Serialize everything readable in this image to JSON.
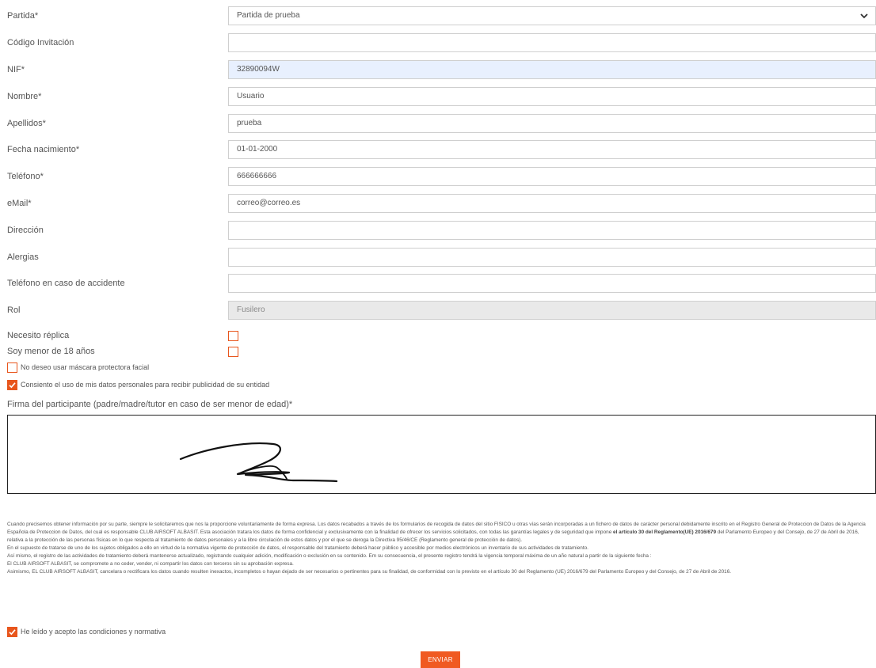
{
  "form": {
    "fields": [
      {
        "label": "Partida*",
        "value": "Partida de prueba",
        "type": "select"
      },
      {
        "label": "Código Invitación",
        "value": "",
        "type": "text"
      },
      {
        "label": "NIF*",
        "value": "32890094W",
        "type": "text"
      },
      {
        "label": "Nombre*",
        "value": "Usuario",
        "type": "text"
      },
      {
        "label": "Apellidos*",
        "value": "prueba",
        "type": "text"
      },
      {
        "label": "Fecha nacimiento*",
        "value": "01-01-2000",
        "type": "text"
      },
      {
        "label": "Teléfono*",
        "value": "666666666",
        "type": "text"
      },
      {
        "label": "eMail*",
        "value": "correo@correo.es",
        "type": "text"
      },
      {
        "label": "Dirección",
        "value": "",
        "type": "text"
      },
      {
        "label": "Alergias",
        "value": "",
        "type": "text"
      },
      {
        "label": "Teléfono en caso de accidente",
        "value": "",
        "type": "text"
      },
      {
        "label": "Rol",
        "value": "Fusilero",
        "type": "text"
      }
    ],
    "checkboxes": [
      {
        "label": "Necesito réplica",
        "checked": false
      },
      {
        "label": "Soy menor de 18 años",
        "checked": false
      },
      {
        "label": "No deseo usar máscara protectora facial",
        "checked": false
      },
      {
        "label": "Consiento el uso de mis datos personales para recibir publicidad de su entidad",
        "checked": true
      }
    ],
    "signature_label": "Firma del participante (padre/madre/tutor en caso de ser menor de edad)*",
    "legal": {
      "p1_a": "Cuando precisemos obtener información por su parte, siempre le solicitaremos que nos la proporcione voluntariamente de forma expresa. Los datos recabados a través de los formularios de recogida de datos del sitio FISICO u otras vías serán incorporadas a un fichero de datos de carácter personal debidamente inscrito en el Registro General de Proteccion de Datos de la Agencia Española de Proteccion de Datos, del cual es responsable CLUB AIRSOFT ALBASIT. Esta asociación tratara los datos de forma confidencial y exclusivamente con la finalidad de ofrecer los servicios solicitados, con todas las garantías legales y de seguridad que impone ",
      "p1_bold": "el artículo 30 del Reglamento(UE) 2016/679",
      "p1_b": " del Parlamento Europeo y del Consejo, de 27 de Abril de 2016, relativa a la protección de las personas físicas en lo que respecta al tratamiento de datos personales y a la libre circulación de estos datos y por el que se deroga la Directiva 95/46/CE (Reglamento general de protección de datos).",
      "p2": "En el supuesto de tratarse de uno de los sujetos obligados a ello en virtud de la normativa vigente de protección de datos, el responsable del tratamiento deberá hacer público y accesible por medios electrónicos un inventario de sus actividades de tratamiento.",
      "p3": "Así mismo, el registro de las actividades de tratamiento deberá mantenerse actualizado, registrando cualquier adición, modificación o exclusión en su contenido. Em su consecuencia, el presente registro tendrá la vigencia temporal máxima de un año natural a partir de la siguiente fecha :",
      "p4": "El CLUB AIRSOFT ALBASIT, se compromete a no ceder, vender, ni compartir los datos con terceros sin su aprobación expresa.",
      "p5": "Asimismo, EL CLUB AIRSOFT ALBASIT, cancelara o rectificara los datos cuando resulten inexactos, incompletos o hayan dejado de ser necesarios o pertinentes para su finalidad, de conformidad con lo previsto en el artículo 30 del Reglamento (UE) 2016/679 del Parlamento Europeo y del Consejo, de 27 de Abril de 2016."
    },
    "accept_label": "He leído y acepto las condiciones y normativa",
    "accept_checked": true,
    "submit_label": "ENVIAR",
    "accent_color": "#f05a22"
  }
}
